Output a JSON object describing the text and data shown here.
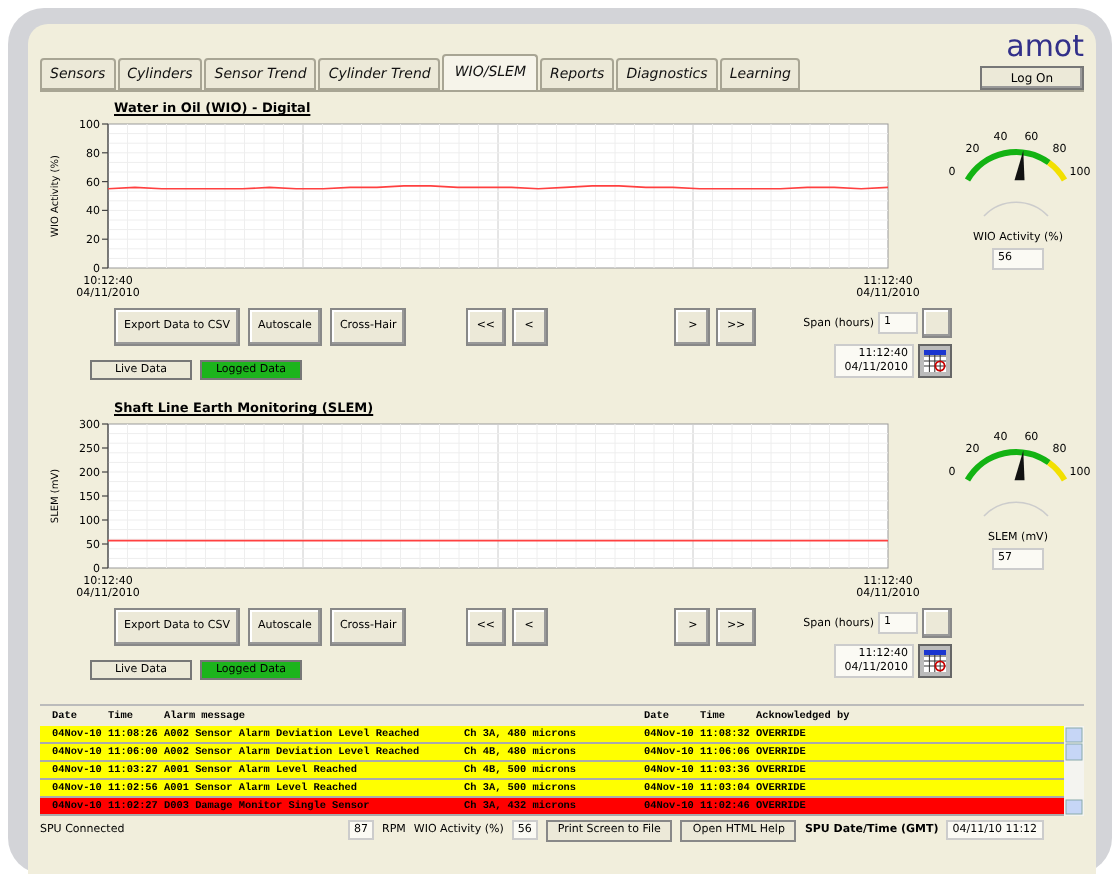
{
  "logo": "amot",
  "login_button": "Log On",
  "tabs": [
    {
      "label": "Sensors",
      "selected": false
    },
    {
      "label": "Cylinders",
      "selected": false
    },
    {
      "label": "Sensor Trend",
      "selected": false
    },
    {
      "label": "Cylinder Trend",
      "selected": false
    },
    {
      "label": "WIO/SLEM",
      "selected": true
    },
    {
      "label": "Reports",
      "selected": false
    },
    {
      "label": "Diagnostics",
      "selected": false
    },
    {
      "label": "Learning",
      "selected": false
    }
  ],
  "panels": [
    {
      "title": "Water in Oil (WIO) - Digital",
      "x_start": [
        "10:12:40",
        "04/11/2010"
      ],
      "x_end": [
        "11:12:40",
        "04/11/2010"
      ],
      "chart_data": {
        "type": "line",
        "ylabel": "WIO Activity (%)",
        "ylim": [
          0,
          100
        ],
        "yticks": [
          0,
          20,
          40,
          60,
          80,
          100
        ],
        "grid": true,
        "series": [
          {
            "color": "#ff4040",
            "values": [
              55,
              56,
              55,
              55,
              55,
              55,
              56,
              55,
              55,
              56,
              56,
              57,
              57,
              56,
              56,
              56,
              55,
              56,
              57,
              57,
              56,
              56,
              55,
              55,
              55,
              55,
              56,
              56,
              55,
              56
            ]
          }
        ]
      },
      "buttons": [
        "Export Data to CSV",
        "Autoscale",
        "Cross-Hair"
      ],
      "nav_left": [
        "<<",
        "<"
      ],
      "nav_right": [
        ">",
        ">>"
      ],
      "span_label": "Span (hours)",
      "span_value": "1",
      "time_value": [
        "11:12:40",
        "04/11/2010"
      ],
      "modes": [
        {
          "label": "Live Data",
          "selected": false
        },
        {
          "label": "Logged Data",
          "selected": true
        }
      ],
      "gauge": {
        "ticks": [
          "0",
          "20",
          "40",
          "60",
          "80",
          "100"
        ],
        "label": "WIO Activity (%)",
        "reading": "56"
      }
    },
    {
      "title": "Shaft Line Earth Monitoring (SLEM)",
      "x_start": [
        "10:12:40",
        "04/11/2010"
      ],
      "x_end": [
        "11:12:40",
        "04/11/2010"
      ],
      "chart_data": {
        "type": "line",
        "ylabel": "SLEM (mV)",
        "ylim": [
          0,
          300
        ],
        "yticks": [
          0,
          50,
          100,
          150,
          200,
          250,
          300
        ],
        "grid": true,
        "series": [
          {
            "color": "#ff4040",
            "values": [
              57,
              57,
              57,
              57,
              57,
              57,
              57,
              57,
              57,
              57
            ]
          }
        ]
      },
      "buttons": [
        "Export Data to CSV",
        "Autoscale",
        "Cross-Hair"
      ],
      "nav_left": [
        "<<",
        "<"
      ],
      "nav_right": [
        ">",
        ">>"
      ],
      "span_label": "Span (hours)",
      "span_value": "1",
      "time_value": [
        "11:12:40",
        "04/11/2010"
      ],
      "modes": [
        {
          "label": "Live Data",
          "selected": false
        },
        {
          "label": "Logged Data",
          "selected": true
        }
      ],
      "gauge": {
        "ticks": [
          "0",
          "20",
          "40",
          "60",
          "80",
          "100"
        ],
        "label": "SLEM (mV)",
        "reading": "57"
      }
    }
  ],
  "alarms": {
    "columns": [
      "Date",
      "Time",
      "Alarm message",
      "",
      "Date",
      "Time",
      "Acknowledged by"
    ],
    "rows": [
      {
        "color": "#ffff00",
        "cells": [
          "04Nov-10",
          "11:08:26",
          "A002 Sensor Alarm Deviation Level Reached",
          "Ch 3A, 480 microns",
          "04Nov-10",
          "11:08:32",
          "OVERRIDE"
        ]
      },
      {
        "color": "#ffff00",
        "cells": [
          "04Nov-10",
          "11:06:00",
          "A002 Sensor Alarm Deviation Level Reached",
          "Ch 4B, 480 microns",
          "04Nov-10",
          "11:06:06",
          "OVERRIDE"
        ]
      },
      {
        "color": "#ffff00",
        "cells": [
          "04Nov-10",
          "11:03:27",
          "A001 Sensor Alarm Level Reached",
          "Ch 4B, 500 microns",
          "04Nov-10",
          "11:03:36",
          "OVERRIDE"
        ]
      },
      {
        "color": "#ffff00",
        "cells": [
          "04Nov-10",
          "11:02:56",
          "A001 Sensor Alarm Level Reached",
          "Ch 3A, 500 microns",
          "04Nov-10",
          "11:03:04",
          "OVERRIDE"
        ]
      },
      {
        "color": "#ff0000",
        "cells": [
          "04Nov-10",
          "11:02:27",
          "D003 Damage Monitor Single Sensor",
          "Ch 3A, 432 microns",
          "04Nov-10",
          "11:02:46",
          "OVERRIDE"
        ]
      }
    ]
  },
  "status_bar": {
    "connection": "SPU Connected",
    "rpm_value": "87",
    "rpm_label": "RPM",
    "wio_label": "WIO Activity (%)",
    "wio_value": "56",
    "buttons": [
      "Print Screen to File",
      "Open HTML Help"
    ],
    "time_label": "SPU Date/Time (GMT)",
    "time_value": "04/11/10 11:12"
  }
}
